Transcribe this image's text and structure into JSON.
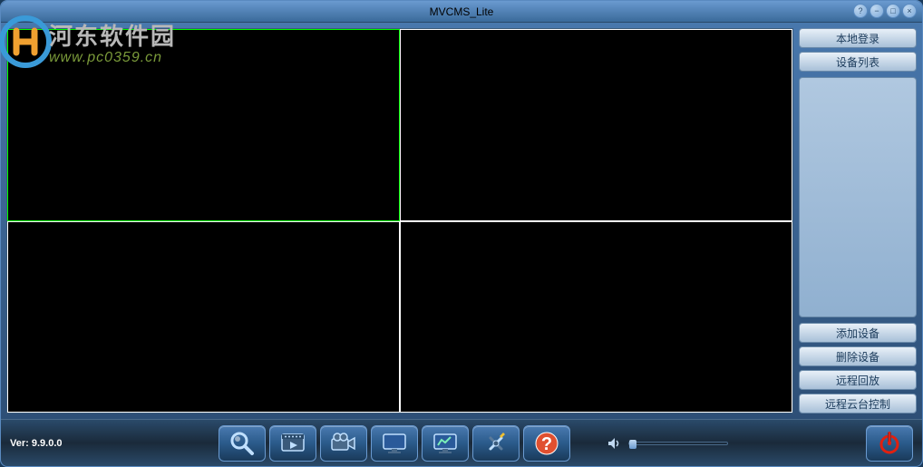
{
  "title": "MVCMS_Lite",
  "watermark": {
    "cn": "河东软件园",
    "url": "www.pc0359.cn"
  },
  "sidebar": {
    "top": [
      {
        "label": "本地登录",
        "name": "local-login-button"
      },
      {
        "label": "设备列表",
        "name": "device-list-button"
      }
    ],
    "bottom": [
      {
        "label": "添加设备",
        "name": "add-device-button"
      },
      {
        "label": "删除设备",
        "name": "delete-device-button"
      },
      {
        "label": "远程回放",
        "name": "remote-playback-button"
      },
      {
        "label": "远程云台控制",
        "name": "remote-ptz-button"
      }
    ]
  },
  "version_label": "Ver: 9.9.0.0",
  "toolbar": [
    {
      "name": "search-icon"
    },
    {
      "name": "playback-icon"
    },
    {
      "name": "record-icon"
    },
    {
      "name": "display-icon"
    },
    {
      "name": "monitor-icon"
    },
    {
      "name": "settings-icon"
    },
    {
      "name": "help-icon"
    }
  ]
}
